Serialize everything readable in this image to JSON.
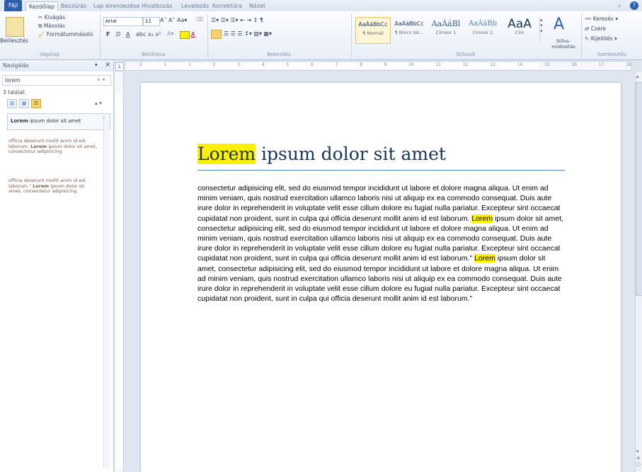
{
  "tabs": [
    "Fájl",
    "Kezdőlap",
    "Beszúrás",
    "Lap elrendezése",
    "Hivatkozás",
    "Levelezés",
    "Korrektúra",
    "Nézet"
  ],
  "ribbon": {
    "clipboard": {
      "paste": "Beillesztés",
      "cut": "Kivágás",
      "copy": "Másolás",
      "format_painter": "Formátummásoló",
      "label": "Vágólap"
    },
    "font": {
      "name": "Arial",
      "size": "11",
      "label": "Betűtípus",
      "bold": "F",
      "italic": "D",
      "underline": "A"
    },
    "paragraph": {
      "label": "Bekezdés"
    },
    "styles": {
      "label": "Stílusok",
      "items": [
        {
          "sample": "AaÁáBbCc",
          "name": "¶ Normál"
        },
        {
          "sample": "AaÁáBbCc",
          "name": "¶ Nincs tér..."
        },
        {
          "sample": "AaÁáBl",
          "name": "Címsor 1"
        },
        {
          "sample": "AaÁáBb",
          "name": "Címsor 2"
        },
        {
          "sample": "AaA",
          "name": "Cím"
        }
      ],
      "change": "Stílus-módosítás"
    },
    "editing": {
      "label": "Szerkesztés",
      "find": "Keresés",
      "replace": "Csere",
      "select": "Kijelölés"
    }
  },
  "nav": {
    "title": "Navigálás",
    "search_value": "lorem",
    "results_count": "3 találat",
    "results": [
      {
        "bold": "Lorem",
        "text": " ipsum dolor sit amet"
      },
      {
        "pre": "officia deserunt mollit anim id est laborum. ",
        "bold": "Lorem",
        "text": " ipsum dolor sit amet, consectetur adipisicing"
      },
      {
        "pre": "officia deserunt mollit anim id est laborum.\" ",
        "bold": "Lorem",
        "text": " ipsum dolor sit amet, consectetur adipisicing"
      }
    ]
  },
  "ruler": {
    "ticks": [
      "2",
      "1",
      "1",
      "2",
      "3",
      "4",
      "5",
      "6",
      "7",
      "8",
      "9",
      "10",
      "11",
      "12",
      "13",
      "14",
      "15",
      "16",
      "17",
      "18"
    ]
  },
  "document": {
    "title_highlight": "Lorem",
    "title_rest": " ipsum dolor sit amet",
    "p1": "consectetur adipisicing elit, sed do eiusmod tempor incididunt ut labore et dolore magna aliqua. Ut enim ad minim veniam, quis nostrud exercitation ullamco laboris nisi ut aliquip ex ea commodo consequat. Duis aute irure dolor in reprehenderit in voluptate velit esse cillum dolore eu fugiat nulla pariatur. Excepteur sint occaecat cupidatat non proident, sunt in culpa qui officia deserunt mollit anim id est laborum. ",
    "hl1": "Lorem",
    "p2": " ipsum dolor sit amet, consectetur adipisicing elit, sed do eiusmod tempor incididunt ut labore et dolore magna aliqua. Ut enim ad minim veniam, quis nostrud exercitation ullamco laboris nisi ut aliquip ex ea commodo consequat. Duis aute irure dolor in reprehenderit in voluptate velit esse cillum dolore eu fugiat nulla pariatur. Excepteur sint occaecat cupidatat non proident, sunt in culpa qui officia deserunt mollit anim id est laborum.\" ",
    "hl2": "Lorem",
    "p3": " ipsum dolor sit amet, consectetur adipisicing elit, sed do eiusmod tempor incididunt ut labore et dolore magna aliqua. Ut enim ad minim veniam, quis nostrud exercitation ullamco laboris nisi ut aliquip ex ea commodo consequat. Duis aute irure dolor in reprehenderit in voluptate velit esse cillum dolore eu fugiat nulla pariatur. Excepteur sint occaecat cupidatat non proident, sunt in culpa qui officia deserunt mollit anim id est laborum.\""
  },
  "colors": {
    "highlight": "#ffef00",
    "title": "#17365d",
    "accent": "#2a5fb0"
  }
}
